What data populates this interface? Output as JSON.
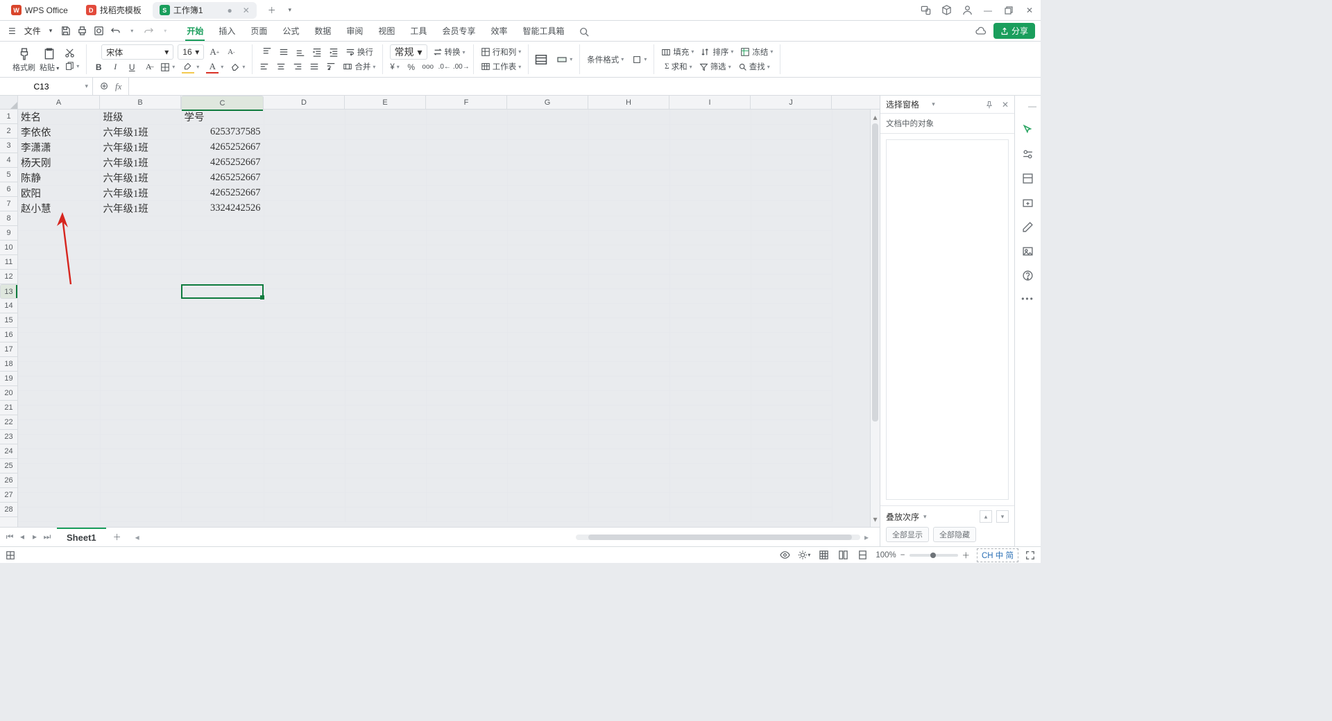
{
  "titlebar": {
    "tabs": [
      {
        "label": "WPS Office",
        "icon_bg": "#d9452b",
        "icon_text": "W"
      },
      {
        "label": "找稻壳模板",
        "icon_bg": "#e24a3b",
        "icon_text": "D"
      },
      {
        "label": "工作簿1",
        "icon_bg": "#1a9e5c",
        "icon_text": "S",
        "modified": "●",
        "active": true
      }
    ]
  },
  "menubar": {
    "file_label": "文件",
    "tabs": [
      "开始",
      "插入",
      "页面",
      "公式",
      "数据",
      "审阅",
      "视图",
      "工具",
      "会员专享",
      "效率",
      "智能工具箱"
    ],
    "active_index": 0,
    "share_label": "分享"
  },
  "ribbon": {
    "format_brush": "格式刷",
    "paste": "粘贴",
    "font": "宋体",
    "font_size": "16",
    "wrap": "换行",
    "merge": "合并",
    "number_format": "常规",
    "convert": "转换",
    "row_col": "行和列",
    "worksheet": "工作表",
    "cond_format": "条件格式",
    "fill": "填充",
    "sort": "排序",
    "freeze": "冻结",
    "sum": "求和",
    "filter": "筛选",
    "find": "查找"
  },
  "namebox": {
    "value": "C13"
  },
  "formula": {
    "value": ""
  },
  "columns": [
    "A",
    "B",
    "C",
    "D",
    "E",
    "F",
    "G",
    "H",
    "I",
    "J"
  ],
  "selected_col": "C",
  "selected_row": 13,
  "selected_cell": "C13",
  "sheet_data": {
    "headers": {
      "A": "姓名",
      "B": "班级",
      "C": "学号"
    },
    "rows": [
      {
        "A": "李依依",
        "B": "六年级1班",
        "C": "6253737585"
      },
      {
        "A": "李潇潇",
        "B": "六年级1班",
        "C": "4265252667"
      },
      {
        "A": "杨天刚",
        "B": "六年级1班",
        "C": "4265252667"
      },
      {
        "A": "陈静",
        "B": "六年级1班",
        "C": "4265252667"
      },
      {
        "A": "欧阳",
        "B": "六年级1班",
        "C": "4265252667"
      },
      {
        "A": "赵小慧",
        "B": "六年级1班",
        "C": "3324242526"
      }
    ]
  },
  "sheet_tabs": {
    "active": "Sheet1"
  },
  "side_panel": {
    "title": "选择窗格",
    "subtitle": "文档中的对象",
    "stack_label": "叠放次序",
    "btn_show_all": "全部显示",
    "btn_hide_all": "全部隐藏"
  },
  "status": {
    "zoom_label": "100%",
    "ime": "CH 中 简"
  }
}
